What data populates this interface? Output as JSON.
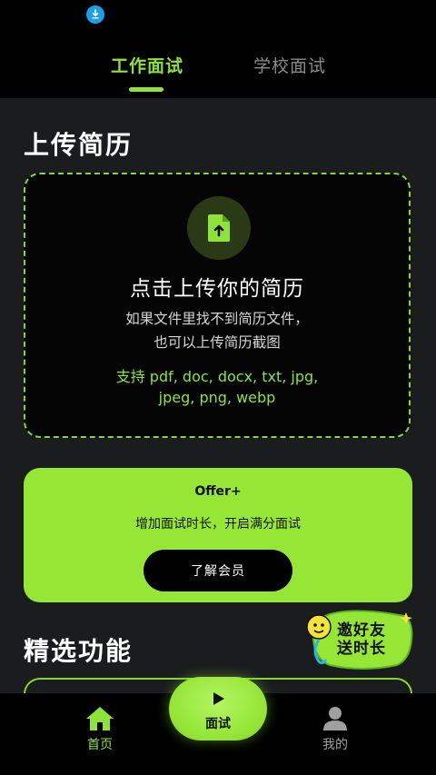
{
  "tabs": {
    "active": "工作面试",
    "inactive": "学校面试"
  },
  "upload_section": {
    "title": "上传简历",
    "card_title": "点击上传你的简历",
    "desc_line1": "如果文件里找不到简历文件，",
    "desc_line2": "也可以上传简历截图",
    "formats_line1": "支持 pdf, doc, docx, txt, jpg,",
    "formats_line2": "jpeg, png, webp"
  },
  "offer_card": {
    "title": "Offer+",
    "subtitle": "增加面试时长，开启满分面试",
    "button_label": "了解会员"
  },
  "features_section": {
    "title": "精选功能"
  },
  "invite_badge": {
    "line1": "邀好友",
    "line2": "送时长"
  },
  "bottom_nav": {
    "home_label": "首页",
    "interview_label": "面试",
    "mine_label": "我的"
  },
  "colors": {
    "accent": "#8ee33a",
    "offer_bg": "#96e636",
    "background": "#1b1c1e",
    "download_icon": "#19a0e8"
  }
}
